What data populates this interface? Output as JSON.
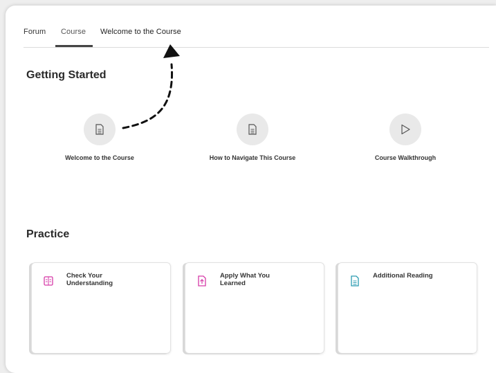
{
  "tabs": {
    "forum": "Forum",
    "course": "Course",
    "welcome": "Welcome to the Course"
  },
  "getting_started": {
    "heading": "Getting Started",
    "items": [
      {
        "label": "Welcome to the Course",
        "icon": "document-icon"
      },
      {
        "label": "How to Navigate This Course",
        "icon": "document-icon"
      },
      {
        "label": "Course Walkthrough",
        "icon": "play-icon"
      }
    ]
  },
  "practice": {
    "heading": "Practice",
    "cards": [
      {
        "title": "Check Your Understanding",
        "icon": "quiz-icon",
        "color": "#d63aa8"
      },
      {
        "title": "Apply What You Learned",
        "icon": "upload-document-icon",
        "color": "#d63aa8"
      },
      {
        "title": "Additional Reading",
        "icon": "reading-document-icon",
        "color": "#2a9bb0"
      }
    ]
  },
  "colors": {
    "active_tab_underline": "#444444",
    "icon_circle_bg": "#e9e9e9"
  }
}
